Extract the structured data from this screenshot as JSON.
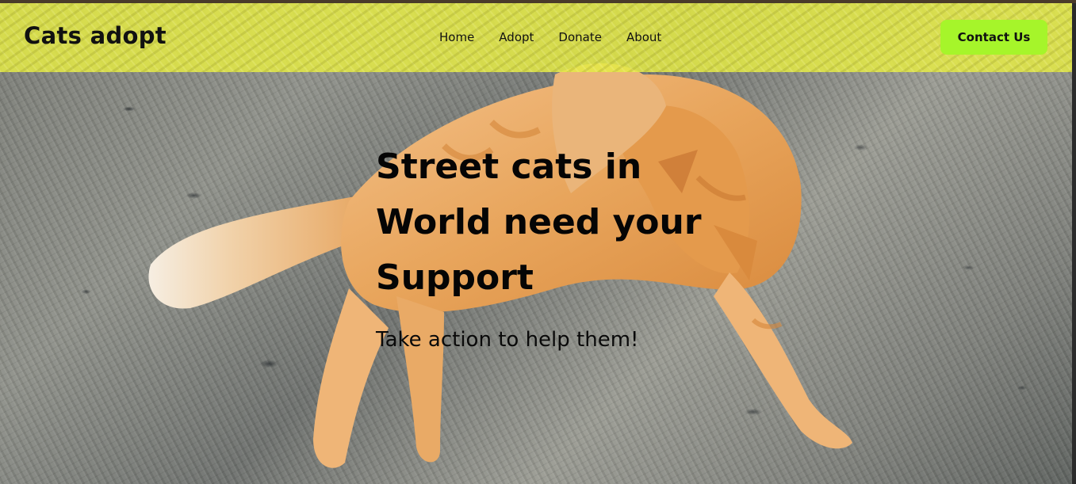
{
  "brand": {
    "name": "Cats adopt"
  },
  "nav": {
    "links": [
      {
        "label": "Home"
      },
      {
        "label": "Adopt"
      },
      {
        "label": "Donate"
      },
      {
        "label": "About"
      }
    ],
    "contact_label": "Contact Us"
  },
  "hero": {
    "title": "Street cats in World need your Support",
    "subtitle": "Take action to help them!"
  },
  "colors": {
    "navbar": "#e4ea46",
    "contact_button": "#a6f52a",
    "cat_fur": "#e8a55c"
  }
}
